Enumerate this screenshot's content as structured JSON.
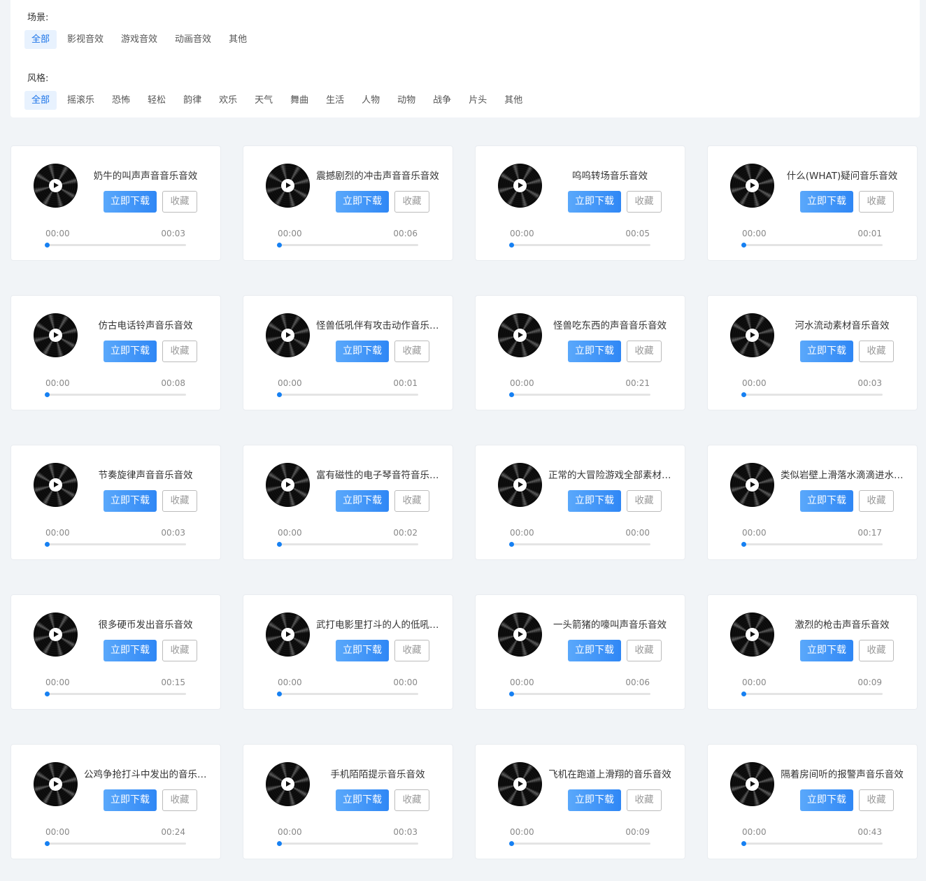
{
  "filters": {
    "scene": {
      "label": "场景:",
      "tags": [
        "全部",
        "影视音效",
        "游戏音效",
        "动画音效",
        "其他"
      ],
      "active": 0
    },
    "style": {
      "label": "风格:",
      "tags": [
        "全部",
        "摇滚乐",
        "恐怖",
        "轻松",
        "韵律",
        "欢乐",
        "天气",
        "舞曲",
        "生活",
        "人物",
        "动物",
        "战争",
        "片头",
        "其他"
      ],
      "active": 0
    }
  },
  "card_labels": {
    "download": "立即下载",
    "favorite": "收藏"
  },
  "accent_color": "#2f87f5",
  "progress_value": 0,
  "tracks": [
    {
      "title": "奶牛的叫声声音音乐音效",
      "current": "00:00",
      "duration": "00:03"
    },
    {
      "title": "震撼剧烈的冲击声音音乐音效",
      "current": "00:00",
      "duration": "00:06"
    },
    {
      "title": "呜呜转场音乐音效",
      "current": "00:00",
      "duration": "00:05"
    },
    {
      "title": "什么(WHAT)疑问音乐音效",
      "current": "00:00",
      "duration": "00:01"
    },
    {
      "title": "仿古电话铃声音乐音效",
      "current": "00:00",
      "duration": "00:08"
    },
    {
      "title": "怪兽低吼伴有攻击动作音乐音效",
      "current": "00:00",
      "duration": "00:01"
    },
    {
      "title": "怪兽吃东西的声音音乐音效",
      "current": "00:00",
      "duration": "00:21"
    },
    {
      "title": "河水流动素材音乐音效",
      "current": "00:00",
      "duration": "00:03"
    },
    {
      "title": "节奏旋律声音音乐音效",
      "current": "00:00",
      "duration": "00:03"
    },
    {
      "title": "富有磁性的电子琴音符音乐音效",
      "current": "00:00",
      "duration": "00:02"
    },
    {
      "title": "正常的大冒险游戏全部素材音效",
      "current": "00:00",
      "duration": "00:00"
    },
    {
      "title": "类似岩壁上滑落水滴滴进水里音效",
      "current": "00:00",
      "duration": "00:17"
    },
    {
      "title": "很多硬币发出音乐音效",
      "current": "00:00",
      "duration": "00:15"
    },
    {
      "title": "武打电影里打斗的人的低吼音效",
      "current": "00:00",
      "duration": "00:00"
    },
    {
      "title": "一头箭猪的嚎叫声音乐音效",
      "current": "00:00",
      "duration": "00:06"
    },
    {
      "title": "激烈的枪击声音乐音效",
      "current": "00:00",
      "duration": "00:09"
    },
    {
      "title": "公鸡争抢打斗中发出的音乐音效",
      "current": "00:00",
      "duration": "00:24"
    },
    {
      "title": "手机陌陌提示音乐音效",
      "current": "00:00",
      "duration": "00:03"
    },
    {
      "title": "飞机在跑道上滑翔的音乐音效",
      "current": "00:00",
      "duration": "00:09"
    },
    {
      "title": "隔着房间听的报警声音乐音效",
      "current": "00:00",
      "duration": "00:43"
    }
  ]
}
